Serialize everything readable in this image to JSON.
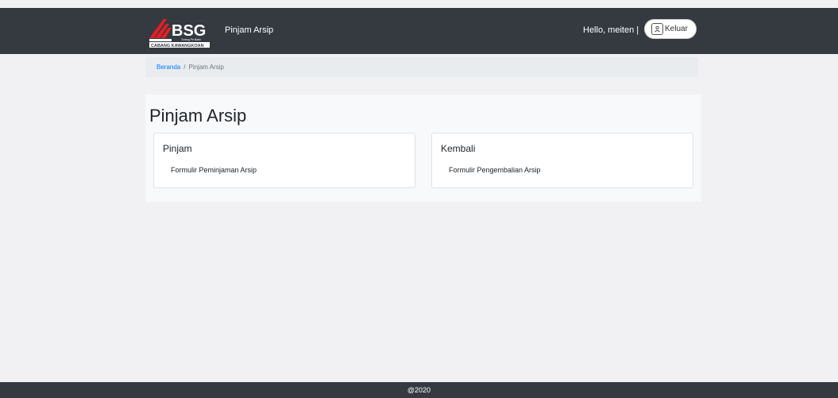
{
  "header": {
    "logo_text": "BSG",
    "logo_subtext": "CABANG KAWANGKOAN",
    "logo_tagline": "Torang Pe Bank",
    "app_title": "Pinjam Arsip",
    "greeting": "Hello, meiten |",
    "logout_label": "Keluar"
  },
  "breadcrumb": {
    "home_label": "Beranda",
    "separator": "/",
    "current_label": "Pinjam Arsip"
  },
  "main": {
    "title": "Pinjam Arsip",
    "cards": [
      {
        "title": "Pinjam",
        "link_label": "Formulir Peminjaman Arsip"
      },
      {
        "title": "Kembali",
        "link_label": "Formulir Pengembalian Arsip"
      }
    ]
  },
  "footer": {
    "text": "@2020"
  },
  "colors": {
    "navbar": "#343a40",
    "breadcrumb_bg": "#e9ecef",
    "link": "#007bff",
    "logo_red": "#e31e24",
    "page_bg": "#f1f1f3"
  },
  "icons": {
    "logout": "user-icon"
  }
}
